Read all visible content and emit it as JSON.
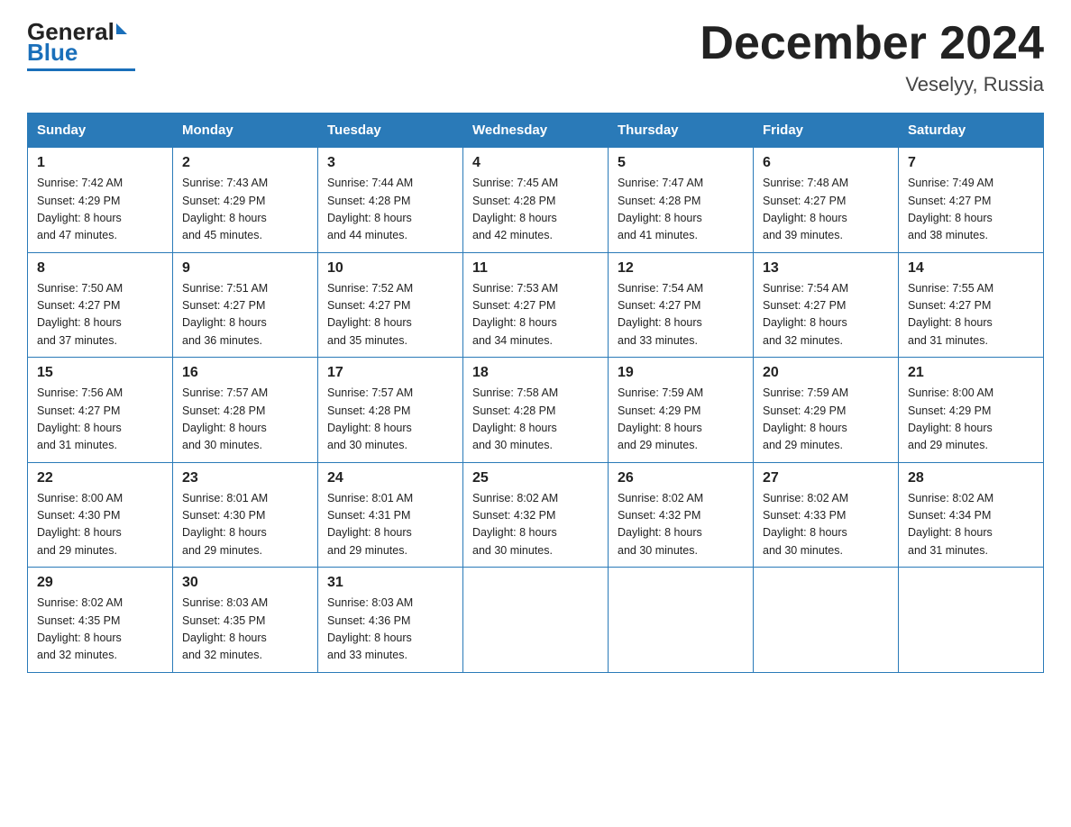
{
  "logo": {
    "general": "General",
    "blue": "Blue"
  },
  "title": {
    "month": "December 2024",
    "location": "Veselyy, Russia"
  },
  "weekdays": [
    "Sunday",
    "Monday",
    "Tuesday",
    "Wednesday",
    "Thursday",
    "Friday",
    "Saturday"
  ],
  "weeks": [
    [
      {
        "day": "1",
        "sunrise": "7:42 AM",
        "sunset": "4:29 PM",
        "daylight": "8 hours and 47 minutes."
      },
      {
        "day": "2",
        "sunrise": "7:43 AM",
        "sunset": "4:29 PM",
        "daylight": "8 hours and 45 minutes."
      },
      {
        "day": "3",
        "sunrise": "7:44 AM",
        "sunset": "4:28 PM",
        "daylight": "8 hours and 44 minutes."
      },
      {
        "day": "4",
        "sunrise": "7:45 AM",
        "sunset": "4:28 PM",
        "daylight": "8 hours and 42 minutes."
      },
      {
        "day": "5",
        "sunrise": "7:47 AM",
        "sunset": "4:28 PM",
        "daylight": "8 hours and 41 minutes."
      },
      {
        "day": "6",
        "sunrise": "7:48 AM",
        "sunset": "4:27 PM",
        "daylight": "8 hours and 39 minutes."
      },
      {
        "day": "7",
        "sunrise": "7:49 AM",
        "sunset": "4:27 PM",
        "daylight": "8 hours and 38 minutes."
      }
    ],
    [
      {
        "day": "8",
        "sunrise": "7:50 AM",
        "sunset": "4:27 PM",
        "daylight": "8 hours and 37 minutes."
      },
      {
        "day": "9",
        "sunrise": "7:51 AM",
        "sunset": "4:27 PM",
        "daylight": "8 hours and 36 minutes."
      },
      {
        "day": "10",
        "sunrise": "7:52 AM",
        "sunset": "4:27 PM",
        "daylight": "8 hours and 35 minutes."
      },
      {
        "day": "11",
        "sunrise": "7:53 AM",
        "sunset": "4:27 PM",
        "daylight": "8 hours and 34 minutes."
      },
      {
        "day": "12",
        "sunrise": "7:54 AM",
        "sunset": "4:27 PM",
        "daylight": "8 hours and 33 minutes."
      },
      {
        "day": "13",
        "sunrise": "7:54 AM",
        "sunset": "4:27 PM",
        "daylight": "8 hours and 32 minutes."
      },
      {
        "day": "14",
        "sunrise": "7:55 AM",
        "sunset": "4:27 PM",
        "daylight": "8 hours and 31 minutes."
      }
    ],
    [
      {
        "day": "15",
        "sunrise": "7:56 AM",
        "sunset": "4:27 PM",
        "daylight": "8 hours and 31 minutes."
      },
      {
        "day": "16",
        "sunrise": "7:57 AM",
        "sunset": "4:28 PM",
        "daylight": "8 hours and 30 minutes."
      },
      {
        "day": "17",
        "sunrise": "7:57 AM",
        "sunset": "4:28 PM",
        "daylight": "8 hours and 30 minutes."
      },
      {
        "day": "18",
        "sunrise": "7:58 AM",
        "sunset": "4:28 PM",
        "daylight": "8 hours and 30 minutes."
      },
      {
        "day": "19",
        "sunrise": "7:59 AM",
        "sunset": "4:29 PM",
        "daylight": "8 hours and 29 minutes."
      },
      {
        "day": "20",
        "sunrise": "7:59 AM",
        "sunset": "4:29 PM",
        "daylight": "8 hours and 29 minutes."
      },
      {
        "day": "21",
        "sunrise": "8:00 AM",
        "sunset": "4:29 PM",
        "daylight": "8 hours and 29 minutes."
      }
    ],
    [
      {
        "day": "22",
        "sunrise": "8:00 AM",
        "sunset": "4:30 PM",
        "daylight": "8 hours and 29 minutes."
      },
      {
        "day": "23",
        "sunrise": "8:01 AM",
        "sunset": "4:30 PM",
        "daylight": "8 hours and 29 minutes."
      },
      {
        "day": "24",
        "sunrise": "8:01 AM",
        "sunset": "4:31 PM",
        "daylight": "8 hours and 29 minutes."
      },
      {
        "day": "25",
        "sunrise": "8:02 AM",
        "sunset": "4:32 PM",
        "daylight": "8 hours and 30 minutes."
      },
      {
        "day": "26",
        "sunrise": "8:02 AM",
        "sunset": "4:32 PM",
        "daylight": "8 hours and 30 minutes."
      },
      {
        "day": "27",
        "sunrise": "8:02 AM",
        "sunset": "4:33 PM",
        "daylight": "8 hours and 30 minutes."
      },
      {
        "day": "28",
        "sunrise": "8:02 AM",
        "sunset": "4:34 PM",
        "daylight": "8 hours and 31 minutes."
      }
    ],
    [
      {
        "day": "29",
        "sunrise": "8:02 AM",
        "sunset": "4:35 PM",
        "daylight": "8 hours and 32 minutes."
      },
      {
        "day": "30",
        "sunrise": "8:03 AM",
        "sunset": "4:35 PM",
        "daylight": "8 hours and 32 minutes."
      },
      {
        "day": "31",
        "sunrise": "8:03 AM",
        "sunset": "4:36 PM",
        "daylight": "8 hours and 33 minutes."
      },
      null,
      null,
      null,
      null
    ]
  ],
  "labels": {
    "sunrise": "Sunrise:",
    "sunset": "Sunset:",
    "daylight": "Daylight:"
  }
}
